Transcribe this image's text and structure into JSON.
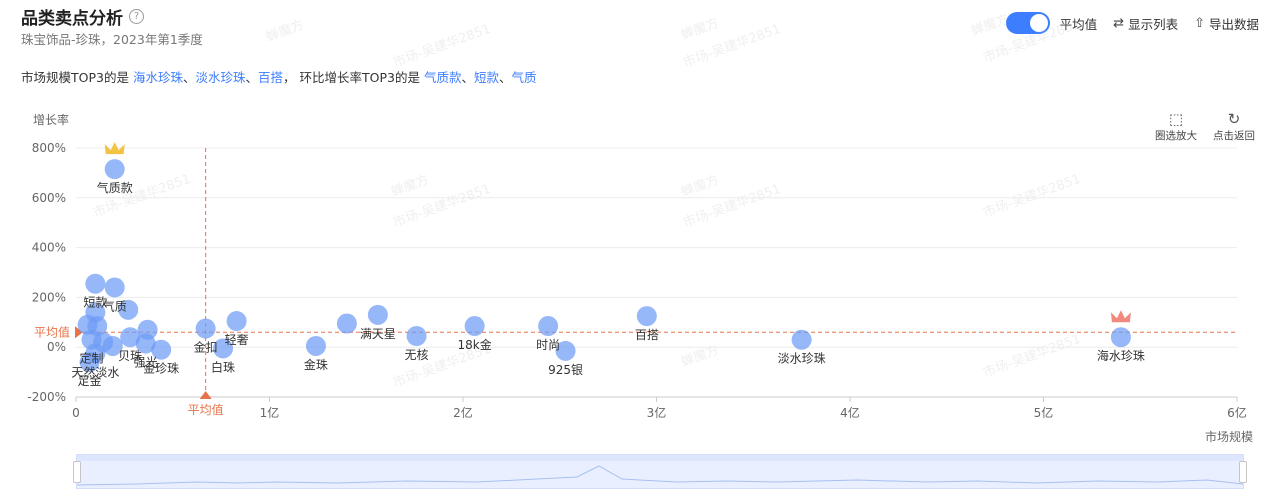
{
  "header": {
    "title": "品类卖点分析",
    "help_icon": "?",
    "subtitle": "珠宝饰品-珍珠，2023年第1季度"
  },
  "toolbar": {
    "avg_toggle_on": true,
    "avg_label": "平均值",
    "list_label": "显示列表",
    "export_label": "导出数据"
  },
  "summary": {
    "prefix": "市场规模TOP3的是 ",
    "market_top3": [
      "海水珍珠",
      "淡水珍珠",
      "百搭"
    ],
    "middle": "， 环比增长率TOP3的是 ",
    "growth_top3": [
      "气质款",
      "短款",
      "气质"
    ],
    "separator": "、"
  },
  "zoom_tools": {
    "box_zoom_label": "圈选放大",
    "reset_label": "点击返回"
  },
  "watermark": [
    "蝉魔方",
    "市场-吴建华2851"
  ],
  "colors": {
    "bubble": "#6e9bf5",
    "accent": "#3d7dff",
    "average_line": "#e8734a",
    "crown_gold": "#f5c342",
    "crown_pink": "#f08a7e"
  },
  "chart_data": {
    "type": "scatter",
    "xlabel": "市场规模",
    "ylabel": "增长率",
    "x_unit": "亿",
    "y_unit": "%",
    "xlim": [
      0,
      6
    ],
    "ylim": [
      -200,
      800
    ],
    "x_ticks": [
      "0",
      "1亿",
      "2亿",
      "3亿",
      "4亿",
      "5亿",
      "6亿"
    ],
    "y_ticks": [
      "-200%",
      "0%",
      "200%",
      "400%",
      "600%",
      "800%"
    ],
    "grid": true,
    "average": {
      "label": "平均值",
      "x": 0.67,
      "y": 60
    },
    "points": [
      {
        "x": 5.4,
        "y": 40,
        "label": "海水珍珠",
        "crown": "pink"
      },
      {
        "x": 3.75,
        "y": 30,
        "label": "淡水珍珠"
      },
      {
        "x": 2.95,
        "y": 125,
        "label": "百搭"
      },
      {
        "x": 2.53,
        "y": -15,
        "label": "925银"
      },
      {
        "x": 2.44,
        "y": 85,
        "label": "时尚"
      },
      {
        "x": 2.06,
        "y": 85,
        "label": "18k金"
      },
      {
        "x": 1.76,
        "y": 45,
        "label": "无核"
      },
      {
        "x": 1.56,
        "y": 130,
        "label": "满天星"
      },
      {
        "x": 1.4,
        "y": 95,
        "label": ""
      },
      {
        "x": 1.24,
        "y": 5,
        "label": "金珠"
      },
      {
        "x": 0.83,
        "y": 105,
        "label": "轻奢"
      },
      {
        "x": 0.76,
        "y": -5,
        "label": "白珠"
      },
      {
        "x": 0.67,
        "y": 75,
        "label": "金扣"
      },
      {
        "x": 0.44,
        "y": -10,
        "label": "金珍珠"
      },
      {
        "x": 0.37,
        "y": 70,
        "label": ""
      },
      {
        "x": 0.36,
        "y": 15,
        "label": "强光"
      },
      {
        "x": 0.27,
        "y": 150,
        "label": ""
      },
      {
        "x": 0.28,
        "y": 40,
        "label": "贝珠"
      },
      {
        "x": 0.2,
        "y": 240,
        "label": "气质"
      },
      {
        "x": 0.2,
        "y": 715,
        "label": "气质款",
        "crown": "gold"
      },
      {
        "x": 0.1,
        "y": 255,
        "label": "短款"
      },
      {
        "x": 0.1,
        "y": 140,
        "label": ""
      },
      {
        "x": 0.06,
        "y": 90,
        "label": ""
      },
      {
        "x": 0.11,
        "y": 85,
        "label": ""
      },
      {
        "x": 0.08,
        "y": 30,
        "label": "定制"
      },
      {
        "x": 0.14,
        "y": 20,
        "label": ""
      },
      {
        "x": 0.19,
        "y": 5,
        "label": ""
      },
      {
        "x": 0.1,
        "y": -25,
        "label": "天然淡水"
      },
      {
        "x": 0.07,
        "y": -60,
        "label": "足金"
      }
    ]
  }
}
